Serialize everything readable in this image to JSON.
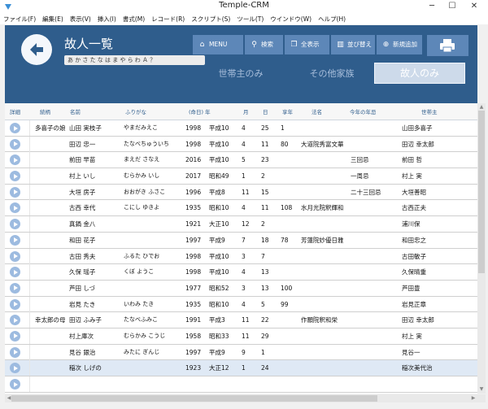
{
  "window": {
    "title": "Temple-CRM",
    "minimize": "─",
    "maximize": "☐",
    "close": "✕"
  },
  "menu": [
    "ファイル(F)",
    "編集(E)",
    "表示(V)",
    "挿入(I)",
    "書式(M)",
    "レコード(R)",
    "スクリプト(S)",
    "ツール(T)",
    "ウインドウ(W)",
    "ヘルプ(H)"
  ],
  "header": {
    "title": "故人一覧",
    "kana_index": "あかさたなはまやらわＡ？",
    "buttons": {
      "menu": "MENU",
      "search": "検索",
      "show_all": "全表示",
      "sort": "並び替え",
      "add_new": "新規追加"
    },
    "filters": {
      "householder_only": "世帯主のみ",
      "other_household": "その他家族",
      "deceased_only": "故人のみ"
    }
  },
  "colors": {
    "header_bg": "#2f5d8c",
    "button_bg": "#5d87b8",
    "selected_row": "#dfe9f5"
  },
  "table": {
    "columns": {
      "detail": "詳細",
      "relation": "続柄",
      "name": "名前",
      "kana": "ふりがな",
      "death_year": "(命日) 年",
      "month": "月",
      "day": "日",
      "age": "享年",
      "dharma_name": "法名",
      "memorial": "今年の年忌",
      "householder": "世帯主"
    },
    "rows": [
      {
        "relation": "多喜子の娘",
        "name": "山田 実枝子",
        "kana": "やまだみえこ",
        "year": "1998",
        "era": "平成10",
        "month": "4",
        "day": "25",
        "age": "1",
        "dharma": "",
        "memorial": "",
        "householder": "山田多喜子"
      },
      {
        "relation": "",
        "name": "田辺 忠一",
        "kana": "たなべちゅういち",
        "year": "1998",
        "era": "平成10",
        "month": "4",
        "day": "11",
        "age": "80",
        "dharma": "大道院秀富文華",
        "memorial": "",
        "householder": "田辺 幸太郎"
      },
      {
        "relation": "",
        "name": "前田 早苗",
        "kana": "まえだ さなえ",
        "year": "2016",
        "era": "平成10",
        "month": "5",
        "day": "23",
        "age": "",
        "dharma": "",
        "memorial": "三回忌",
        "householder": "前田 哲"
      },
      {
        "relation": "",
        "name": "村上 いし",
        "kana": "むらかみ いし",
        "year": "2017",
        "era": "昭和49",
        "month": "1",
        "day": "2",
        "age": "",
        "dharma": "",
        "memorial": "一周忌",
        "householder": "村上 実"
      },
      {
        "relation": "",
        "name": "大垣 房子",
        "kana": "おおがき ふさこ",
        "year": "1996",
        "era": "平成8",
        "month": "11",
        "day": "15",
        "age": "",
        "dharma": "",
        "memorial": "二十三回忌",
        "householder": "大垣善昭"
      },
      {
        "relation": "",
        "name": "古西 幸代",
        "kana": "こにし ゆきよ",
        "year": "1935",
        "era": "昭和10",
        "month": "4",
        "day": "11",
        "age": "108",
        "dharma": "水月光院釈輝和",
        "memorial": "",
        "householder": "古西正夫"
      },
      {
        "relation": "",
        "name": "真鍋 金八",
        "kana": "",
        "year": "1921",
        "era": "大正10",
        "month": "12",
        "day": "2",
        "age": "",
        "dharma": "",
        "memorial": "",
        "householder": "浦川保"
      },
      {
        "relation": "",
        "name": "和田 花子",
        "kana": "",
        "year": "1997",
        "era": "平成9",
        "month": "7",
        "day": "18",
        "age": "78",
        "dharma": "芳蓮院妙優日雅",
        "memorial": "",
        "householder": "和田忠之"
      },
      {
        "relation": "",
        "name": "古田 秀夫",
        "kana": "ふるた ひでお",
        "year": "1998",
        "era": "平成10",
        "month": "3",
        "day": "7",
        "age": "",
        "dharma": "",
        "memorial": "",
        "householder": "古田敏子"
      },
      {
        "relation": "",
        "name": "久保 瑶子",
        "kana": "くぼ ようこ",
        "year": "1998",
        "era": "平成10",
        "month": "4",
        "day": "13",
        "age": "",
        "dharma": "",
        "memorial": "",
        "householder": "久保晴重"
      },
      {
        "relation": "",
        "name": "芦田 しづ",
        "kana": "",
        "year": "1977",
        "era": "昭和52",
        "month": "3",
        "day": "13",
        "age": "100",
        "dharma": "",
        "memorial": "",
        "householder": "芦田豊"
      },
      {
        "relation": "",
        "name": "岩見 たき",
        "kana": "いわみ たき",
        "year": "1935",
        "era": "昭和10",
        "month": "4",
        "day": "5",
        "age": "99",
        "dharma": "",
        "memorial": "",
        "householder": "岩見正章"
      },
      {
        "relation": "幸太郎の母",
        "name": "田辺 ふみ子",
        "kana": "たなべふみこ",
        "year": "1991",
        "era": "平成3",
        "month": "11",
        "day": "22",
        "age": "",
        "dharma": "作願院釈和栄",
        "memorial": "",
        "householder": "田辺 幸太郎"
      },
      {
        "relation": "",
        "name": "村上庫次",
        "kana": "むらかみ こうじ",
        "year": "1958",
        "era": "昭和33",
        "month": "11",
        "day": "29",
        "age": "",
        "dharma": "",
        "memorial": "",
        "householder": "村上 実"
      },
      {
        "relation": "",
        "name": "見谷 銀治",
        "kana": "みたに ぎんじ",
        "year": "1997",
        "era": "平成9",
        "month": "9",
        "day": "1",
        "age": "",
        "dharma": "",
        "memorial": "",
        "householder": "見谷一"
      },
      {
        "relation": "",
        "name": "稲次 しげの",
        "kana": "",
        "year": "1923",
        "era": "大正12",
        "month": "1",
        "day": "24",
        "age": "",
        "dharma": "",
        "memorial": "",
        "householder": "稲次美代治"
      },
      {
        "relation": "",
        "name": "",
        "kana": "",
        "year": "",
        "era": "",
        "month": "",
        "day": "",
        "age": "",
        "dharma": "",
        "memorial": "",
        "householder": ""
      }
    ],
    "selected_index": 15
  }
}
